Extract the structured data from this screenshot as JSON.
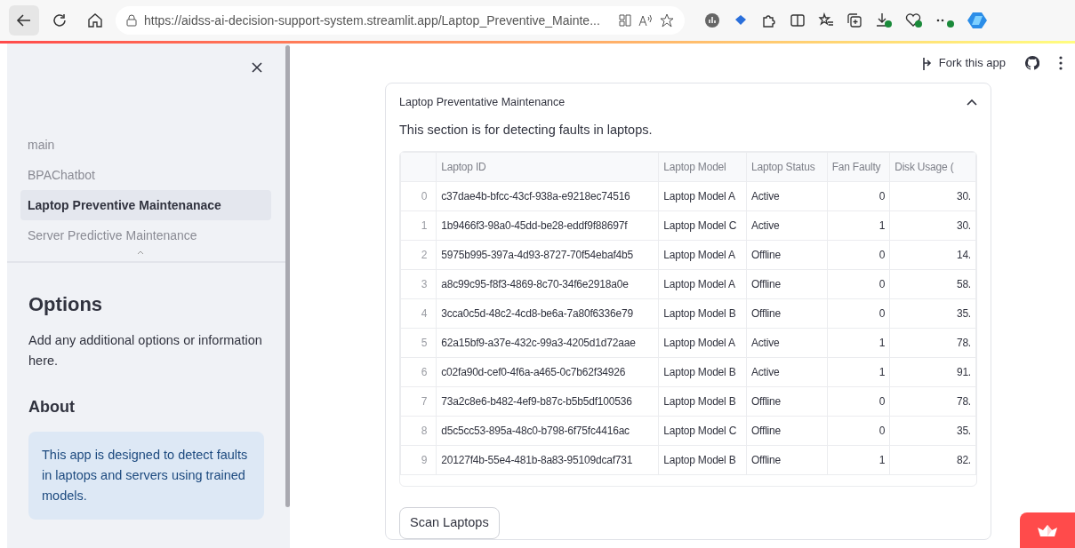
{
  "browser": {
    "url": "https://aidss-ai-decision-support-system.streamlit.app/Laptop_Preventive_Mainte..."
  },
  "sidebar": {
    "items": [
      {
        "label": "main",
        "selected": false
      },
      {
        "label": "BPAChatbot",
        "selected": false
      },
      {
        "label": "Laptop Preventive Maintenanace",
        "selected": true
      },
      {
        "label": "Server Predictive Maintenance",
        "selected": false
      }
    ],
    "options_title": "Options",
    "options_text": "Add any additional options or information here.",
    "about_title": "About",
    "about_text": "This app is designed to detect faults in laptops and servers using trained models."
  },
  "header": {
    "fork_label": "Fork this app"
  },
  "expander": {
    "title": "Laptop Preventative Maintenance",
    "expanded": true,
    "description": "This section is for detecting faults in laptops.",
    "table": {
      "columns": [
        "",
        "Laptop ID",
        "Laptop Model",
        "Laptop Status",
        "Fan Faulty",
        "Disk Usage ("
      ],
      "rows": [
        [
          "0",
          "c37dae4b-bfcc-43cf-938a-e9218ec74516",
          "Laptop Model A",
          "Active",
          "0",
          "30."
        ],
        [
          "1",
          "1b9466f3-98a0-45dd-be28-eddf9f88697f",
          "Laptop Model C",
          "Active",
          "1",
          "30."
        ],
        [
          "2",
          "5975b995-397a-4d93-8727-70f54ebaf4b5",
          "Laptop Model A",
          "Offline",
          "0",
          "14."
        ],
        [
          "3",
          "a8c99c95-f8f3-4869-8c70-34f6e2918a0e",
          "Laptop Model A",
          "Offline",
          "0",
          "58."
        ],
        [
          "4",
          "3cca0c5d-48c2-4cd8-be6a-7a80f6336e79",
          "Laptop Model B",
          "Offline",
          "0",
          "35."
        ],
        [
          "5",
          "62a15bf9-a37e-432c-99a3-4205d1d72aae",
          "Laptop Model A",
          "Active",
          "1",
          "78."
        ],
        [
          "6",
          "c02fa90d-cef0-4f6a-a465-0c7b62f34926",
          "Laptop Model B",
          "Active",
          "1",
          "91."
        ],
        [
          "7",
          "73a2c8e6-b482-4ef9-b87c-b5b5df100536",
          "Laptop Model B",
          "Offline",
          "0",
          "78."
        ],
        [
          "8",
          "d5c5cc53-895a-48c0-b798-6f75fc4416ac",
          "Laptop Model C",
          "Offline",
          "0",
          "35."
        ],
        [
          "9",
          "20127f4b-55e4-481b-8a83-95109dcaf731",
          "Laptop Model B",
          "Offline",
          "1",
          "82."
        ]
      ]
    },
    "button": "Scan Laptops"
  }
}
